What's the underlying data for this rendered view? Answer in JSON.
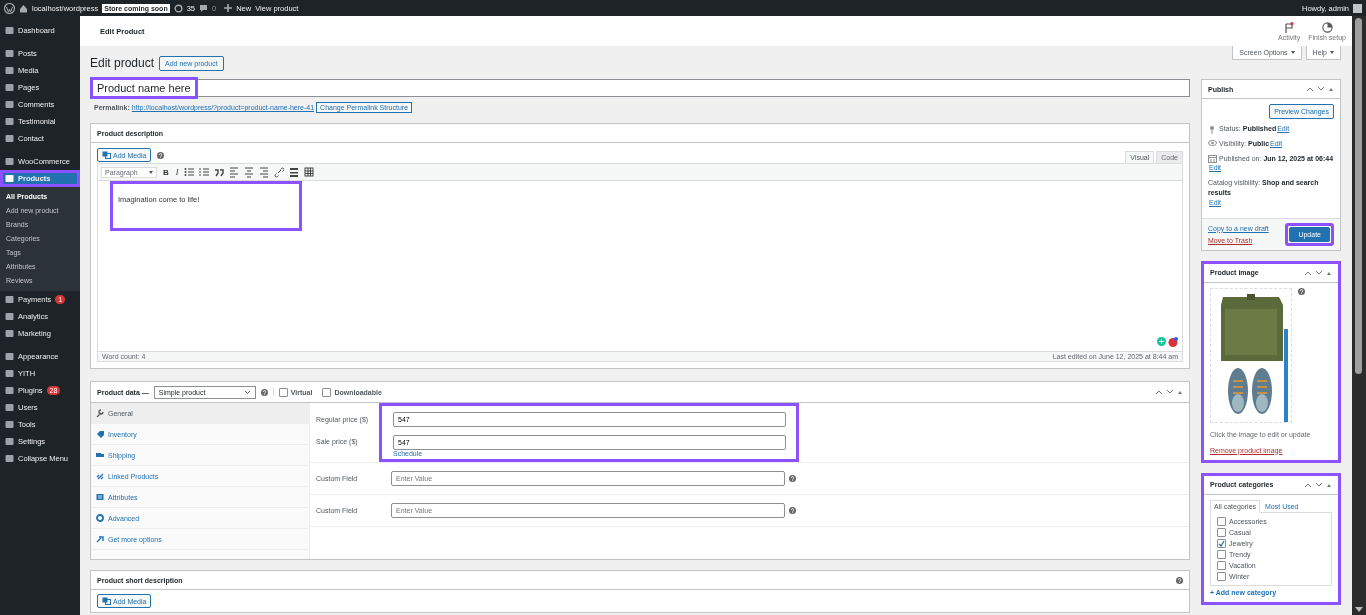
{
  "admin_bar": {
    "site": "localhost/wordpress",
    "store_badge": "Store coming soon",
    "updates": "35",
    "comments": "0",
    "new": "New",
    "view": "View product",
    "greeting": "Howdy, admin"
  },
  "sidebar": {
    "groups": [
      [
        {
          "label": "Dashboard",
          "selected": false
        }
      ],
      [
        {
          "label": "Posts",
          "selected": false
        },
        {
          "label": "Media",
          "selected": false
        },
        {
          "label": "Pages",
          "selected": false
        },
        {
          "label": "Comments",
          "selected": false
        },
        {
          "label": "Testimonial",
          "selected": false
        },
        {
          "label": "Contact",
          "selected": false
        }
      ],
      [
        {
          "label": "WooCommerce",
          "selected": false
        },
        {
          "label": "Products",
          "selected": true,
          "highlighted": true,
          "children": [
            {
              "label": "All Products",
              "selected": true
            },
            {
              "label": "Add new product",
              "selected": false
            },
            {
              "label": "Brands",
              "selected": false
            },
            {
              "label": "Categories",
              "selected": false
            },
            {
              "label": "Tags",
              "selected": false
            },
            {
              "label": "Attributes",
              "selected": false
            },
            {
              "label": "Reviews",
              "selected": false
            }
          ]
        },
        {
          "label": "Payments",
          "selected": false,
          "badge": "1"
        },
        {
          "label": "Analytics",
          "selected": false
        },
        {
          "label": "Marketing",
          "selected": false
        }
      ],
      [
        {
          "label": "Appearance",
          "selected": false
        },
        {
          "label": "YITH",
          "selected": false
        },
        {
          "label": "Plugins",
          "selected": false,
          "badge": "28"
        },
        {
          "label": "Users",
          "selected": false
        },
        {
          "label": "Tools",
          "selected": false
        },
        {
          "label": "Settings",
          "selected": false
        },
        {
          "label": "Collapse Menu",
          "selected": false
        }
      ]
    ]
  },
  "page_header": {
    "title": "Edit Product",
    "actions": [
      {
        "kind": "activity",
        "label": "Activity",
        "notification": true
      },
      {
        "kind": "setup",
        "label": "Finish setup",
        "notification": false
      }
    ]
  },
  "screen_tabs": [
    "Screen Options",
    "Help"
  ],
  "heading": "Edit product",
  "add_new": "Add new product",
  "title": {
    "value": "Product name here",
    "highlighted": true
  },
  "permalink": {
    "label": "Permalink:",
    "url": "http://localhost/wordpress/?product=product-name-here-41",
    "button": "Change Permalink Structure"
  },
  "description": {
    "title": "Product description",
    "add_media": "Add Media",
    "editor_tabs": [
      {
        "label": "Visual",
        "selected": true
      },
      {
        "label": "Code",
        "selected": false
      }
    ],
    "format": "Paragraph",
    "text_buttons": [
      "B",
      "I"
    ],
    "content": "Imagination come to life!",
    "highlighted": true,
    "word_count": "Word count: 4",
    "last_edited": "Last edited on June 12, 2025 at 8:44 am"
  },
  "product_data": {
    "title": "Product data —",
    "type": "Simple product",
    "options": [
      {
        "label": "Virtual",
        "checked": false
      },
      {
        "label": "Downloadable",
        "checked": false
      }
    ],
    "tabs": [
      {
        "label": "General",
        "selected": true
      },
      {
        "label": "Inventory",
        "selected": false
      },
      {
        "label": "Shipping",
        "selected": false
      },
      {
        "label": "Linked Products",
        "selected": false
      },
      {
        "label": "Attributes",
        "selected": false
      },
      {
        "label": "Advanced",
        "selected": false
      },
      {
        "label": "Get more options",
        "selected": false
      }
    ],
    "price_group": {
      "highlighted": true,
      "fields": [
        {
          "label": "Regular price ($)",
          "value": "547"
        },
        {
          "label": "Sale price ($)",
          "value": "547"
        }
      ],
      "link": "Schedule"
    },
    "custom_fields": [
      {
        "label": "Custom Field",
        "placeholder": "Enter Value"
      },
      {
        "label": "Custom Field",
        "placeholder": "Enter Value"
      }
    ]
  },
  "short_description": {
    "title": "Product short description",
    "add_media": "Add Media"
  },
  "publish": {
    "title": "Publish",
    "preview": "Preview Changes",
    "rows": [
      {
        "kind": "status",
        "text": "Status: **Published**",
        "link": "Edit"
      },
      {
        "kind": "visibility",
        "text": "Visibility: **Public**",
        "link": "Edit"
      },
      {
        "kind": "date",
        "text": "Published on: **Jun 12, 2025 at 06:44**",
        "link": "Edit"
      },
      {
        "kind": "plain",
        "text": "Catalog visibility: **Shop and search results**",
        "link": "Edit"
      }
    ],
    "copy": "Copy to a new draft",
    "trash": "Move to Trash",
    "update": {
      "label": "Update",
      "highlighted": true
    }
  },
  "product_image": {
    "title": "Product image",
    "hint": "Click the image to edit or update",
    "remove": "Remove product image",
    "highlighted": true
  },
  "categories": {
    "title": "Product categories",
    "highlighted": true,
    "tabs": [
      {
        "label": "All categories",
        "selected": true
      },
      {
        "label": "Most Used",
        "selected": false
      }
    ],
    "items": [
      {
        "label": "Accessories",
        "checked": false
      },
      {
        "label": "Casual",
        "checked": false
      },
      {
        "label": "Jewelry",
        "checked": true
      },
      {
        "label": "Trendy",
        "checked": false
      },
      {
        "label": "Vacation",
        "checked": false
      },
      {
        "label": "Winter",
        "checked": false
      }
    ],
    "add": "+ Add new category"
  }
}
